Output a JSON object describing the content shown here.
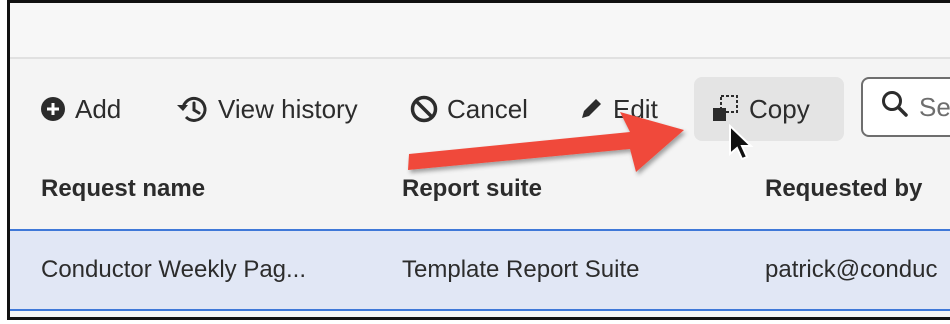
{
  "toolbar": {
    "add_label": "Add",
    "view_history_label": "View history",
    "cancel_label": "Cancel",
    "edit_label": "Edit",
    "copy_label": "Copy",
    "search_placeholder": "Se"
  },
  "table": {
    "columns": [
      "Request name",
      "Report suite",
      "Requested by"
    ],
    "rows": [
      {
        "request_name": "Conductor Weekly Pag...",
        "report_suite": "Template Report Suite",
        "requested_by": "patrick@conduc"
      }
    ]
  },
  "colors": {
    "arrow": "#f04a3b",
    "selected_row": "#e1e7f5",
    "selection_border": "#3f78d8",
    "copy_hover": "#e4e4e4"
  },
  "icons": [
    "add-icon",
    "history-icon",
    "cancel-icon",
    "edit-icon",
    "copy-icon",
    "search-icon",
    "cursor-icon",
    "annotation-arrow"
  ]
}
